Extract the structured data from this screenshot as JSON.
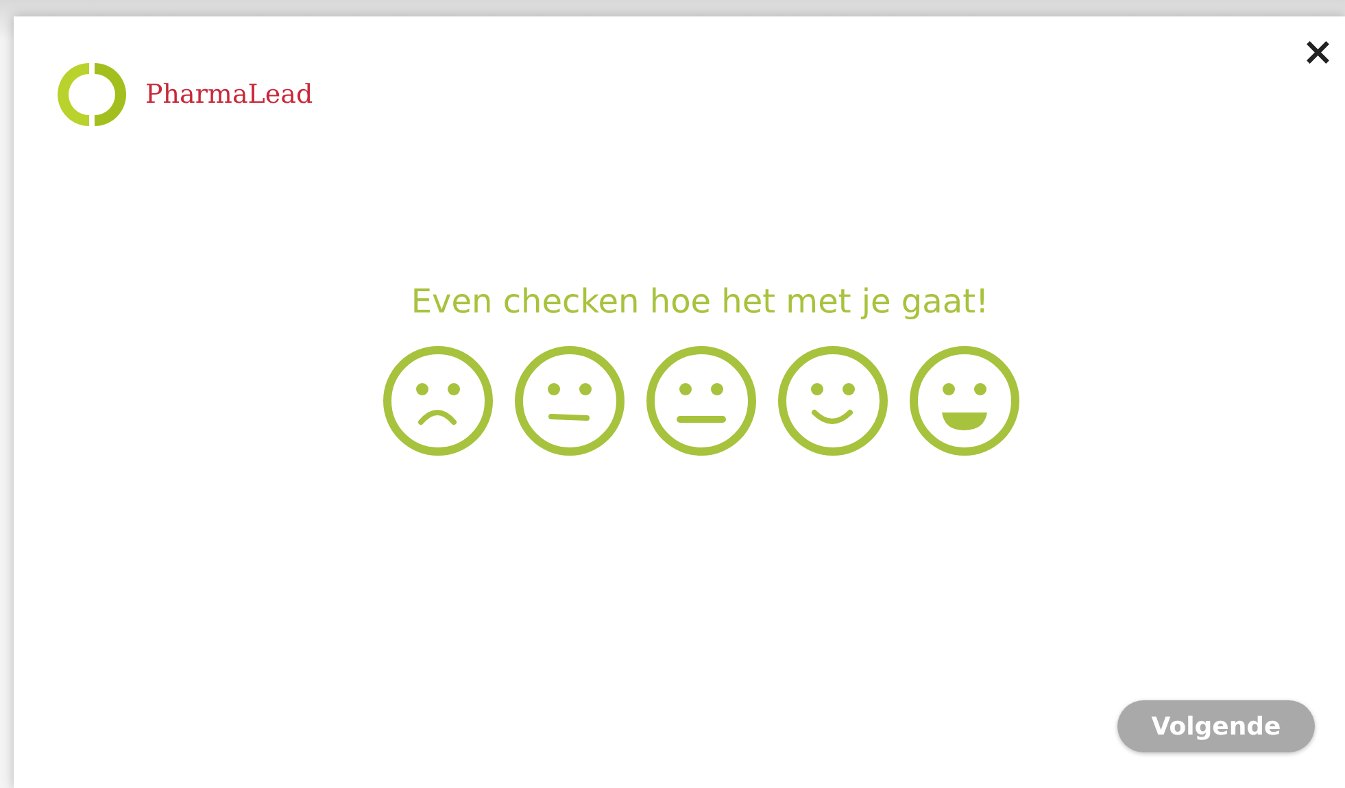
{
  "dialog": {
    "close": "×",
    "brand": "PharmaLead",
    "question": "Even checken hoe het met je gaat!",
    "moods": [
      {
        "kind": "sad",
        "selected": false
      },
      {
        "kind": "meh",
        "selected": false
      },
      {
        "kind": "neutral",
        "selected": false
      },
      {
        "kind": "smile",
        "selected": false
      },
      {
        "kind": "grin",
        "selected": false
      }
    ],
    "next_button": {
      "label": "Volgende",
      "disabled": true
    }
  }
}
